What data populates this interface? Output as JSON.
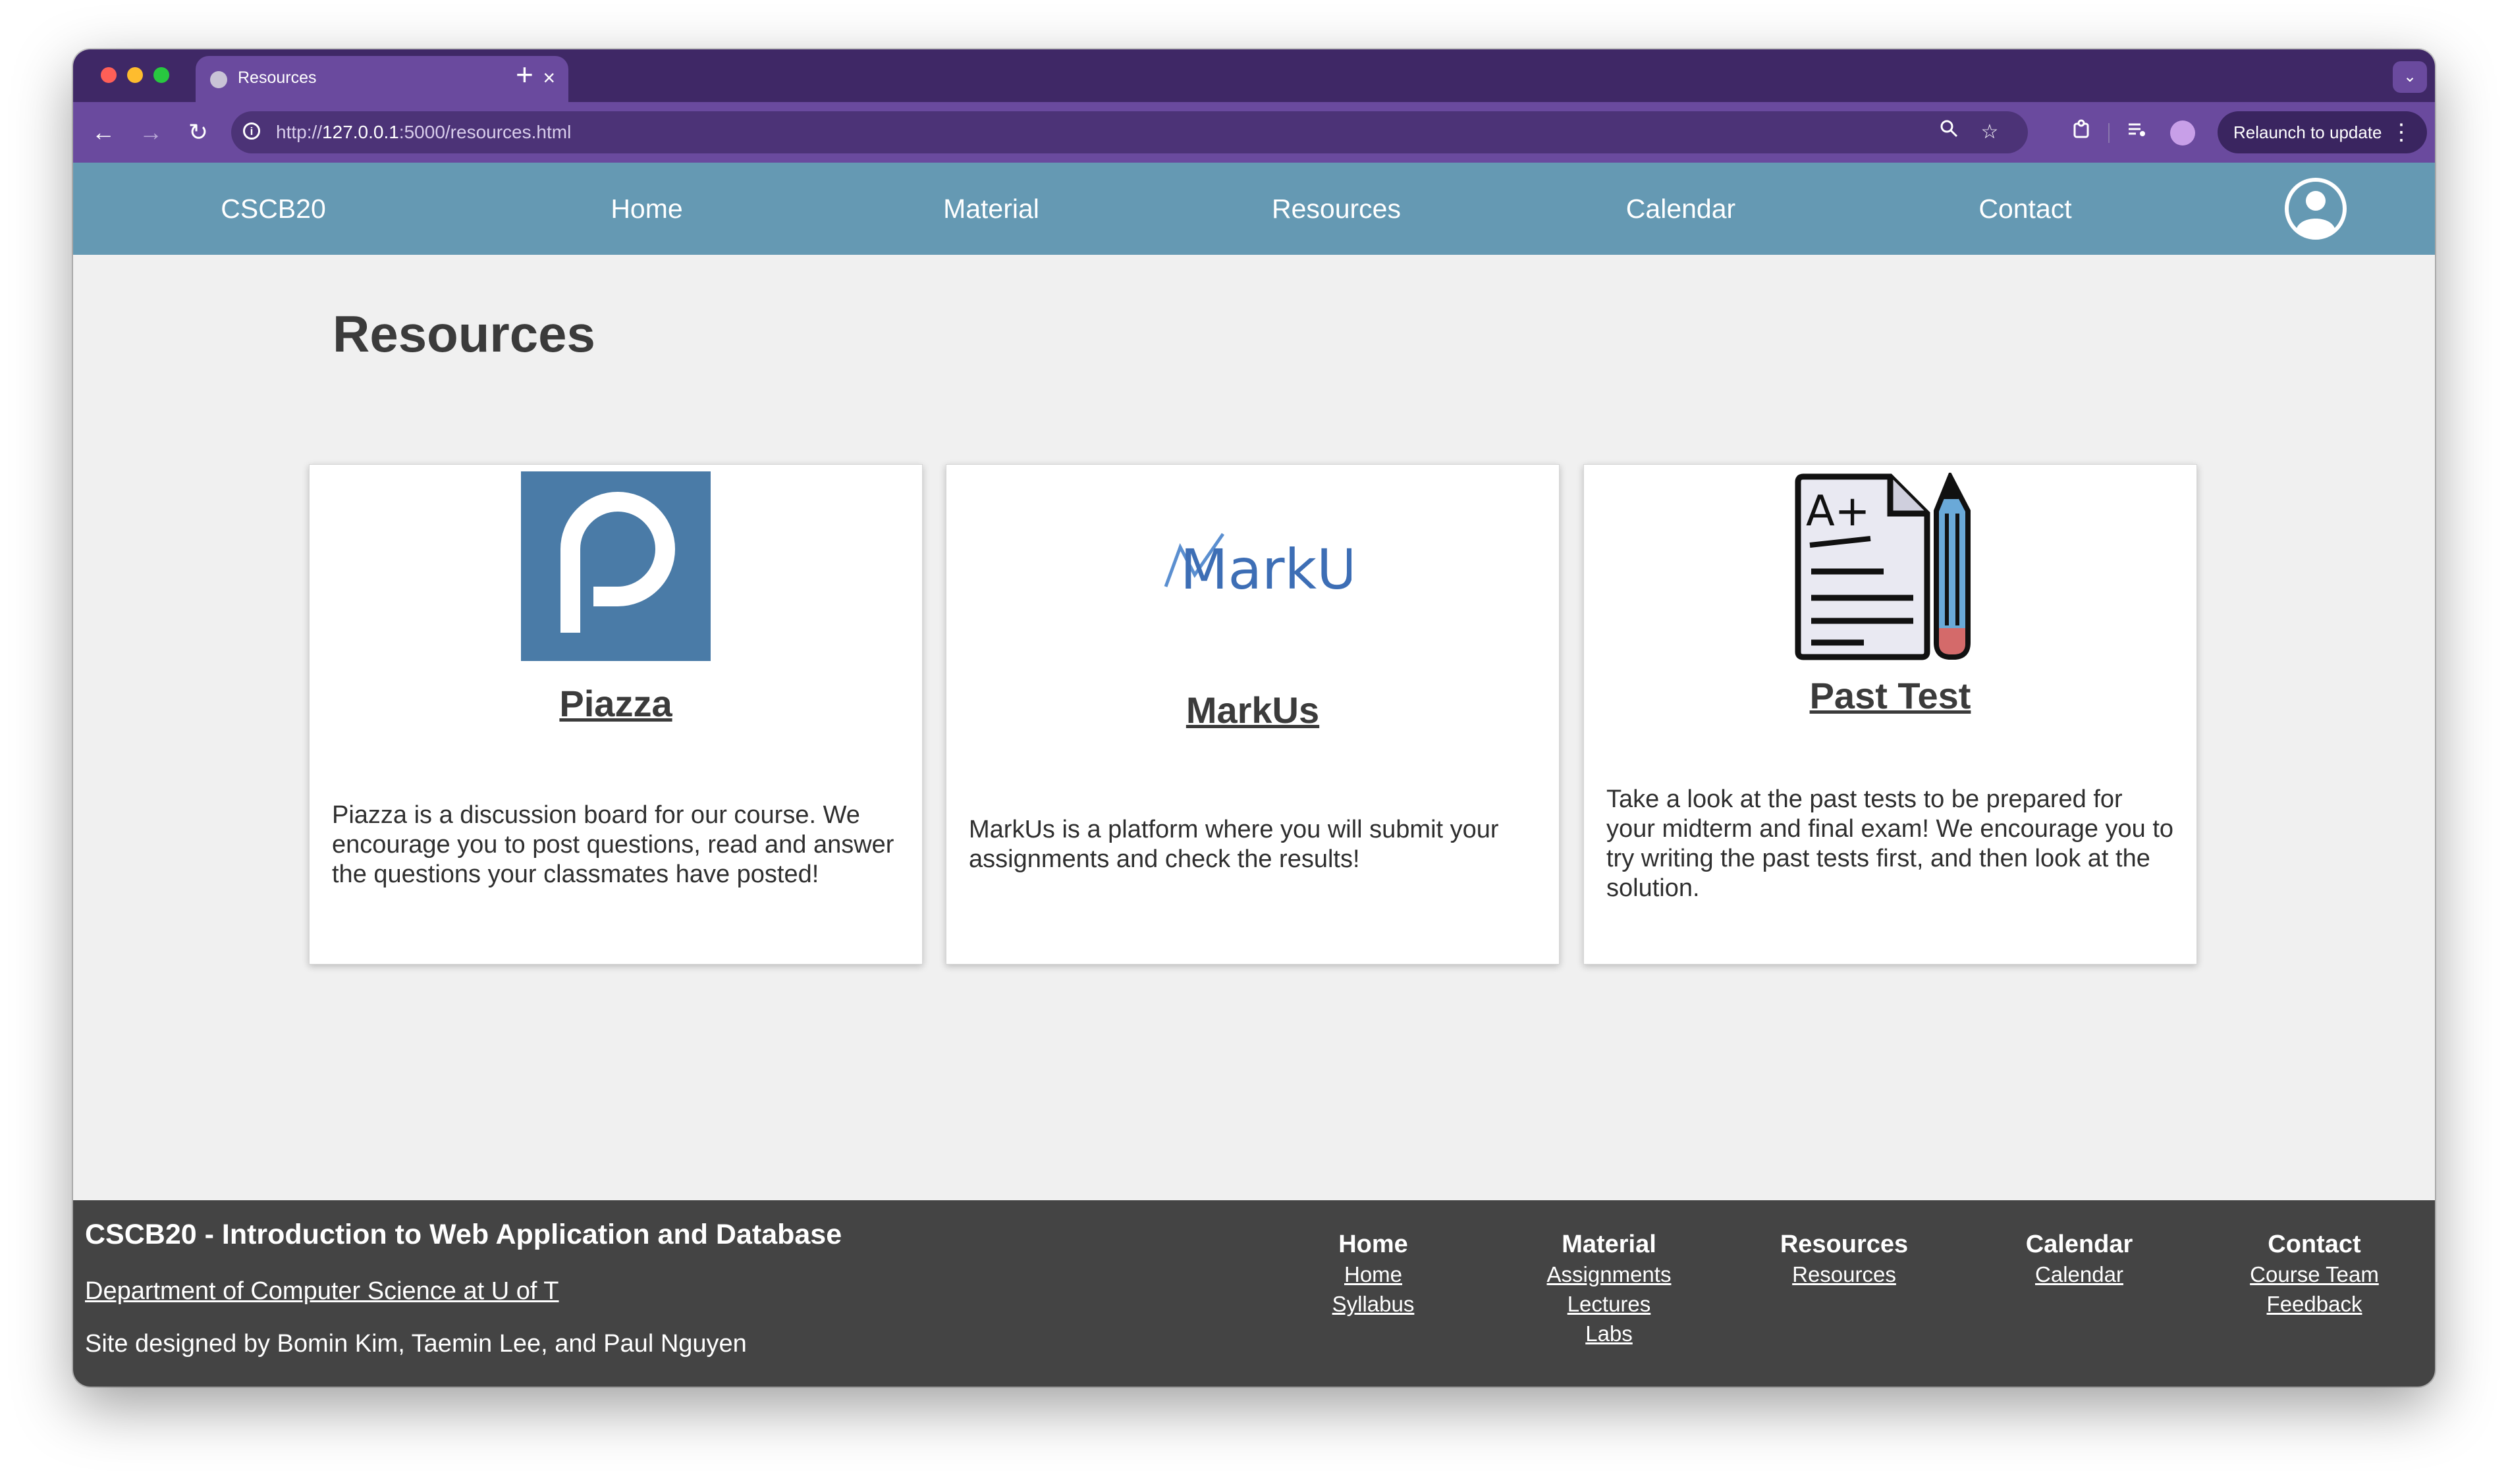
{
  "browser": {
    "tab_title": "Resources",
    "tab_close": "×",
    "new_tab": "+",
    "url_scheme": "http://",
    "url_host": "127.0.0.1",
    "url_rest": ":5000/resources.html",
    "relaunch_label": "Relaunch to update",
    "icons": [
      "back-icon",
      "forward-icon",
      "reload-icon",
      "info-icon",
      "zoom-icon",
      "star-icon",
      "extensions-icon",
      "media-icon",
      "profile-icon",
      "menu-icon"
    ]
  },
  "nav": {
    "brand": "CSCB20",
    "items": [
      "Home",
      "Material",
      "Resources",
      "Calendar",
      "Contact"
    ],
    "account_icon": "user-circle-icon"
  },
  "page": {
    "title": "Resources",
    "cards": [
      {
        "title": "Piazza",
        "logo": "piazza-logo",
        "description": "Piazza is a discussion board for our course. We encourage you to post questions, read and answer the questions your classmates have posted!"
      },
      {
        "title": "MarkUs",
        "logo": "markus-logo",
        "logo_text": "MarkUs",
        "description": "MarkUs is a platform where you will submit your assignments and check the results!"
      },
      {
        "title": "Past Test",
        "logo": "exam-paper-pencil-icon",
        "logo_text": "A+",
        "description": "Take a look at the past tests to be prepared for your midterm and final exam! We encourage you to try writing the past tests first, and then look at the solution."
      }
    ]
  },
  "footer": {
    "title": "CSCB20 - Introduction to Web Application and Database",
    "dept": "Department of Computer Science at U of T",
    "credit": "Site designed by Bomin Kim, Taemin Lee, and Paul Nguyen",
    "columns": [
      {
        "heading": "Home",
        "links": [
          "Home",
          "Syllabus"
        ]
      },
      {
        "heading": "Material",
        "links": [
          "Assignments",
          "Lectures",
          "Labs"
        ]
      },
      {
        "heading": "Resources",
        "links": [
          "Resources"
        ]
      },
      {
        "heading": "Calendar",
        "links": [
          "Calendar"
        ]
      },
      {
        "heading": "Contact",
        "links": [
          "Course Team",
          "Feedback"
        ]
      }
    ]
  },
  "colors": {
    "tabstrip": "#3f2866",
    "toolbar": "#6a4a9e",
    "site_nav": "#6599b3",
    "page_bg": "#f0f0f0",
    "footer_bg": "#444444",
    "piazza_blue": "#4a7ba7",
    "markus_blue": "#3d6eb5"
  }
}
